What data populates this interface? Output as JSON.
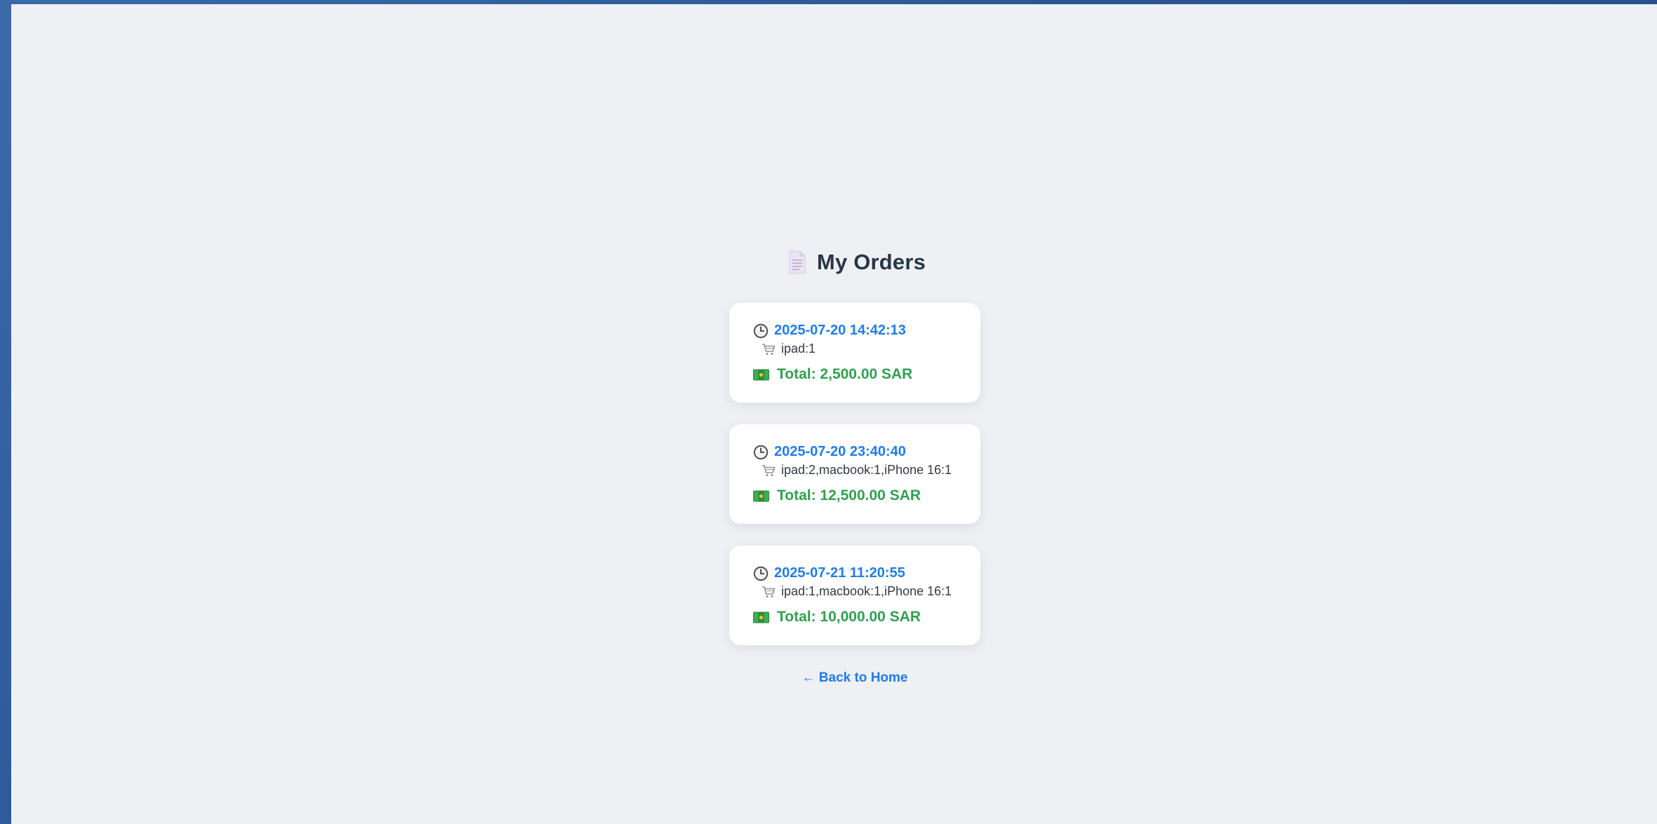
{
  "page": {
    "title": "My Orders",
    "title_icon": "document-icon",
    "background_color": "#eff0f4",
    "frame_color": "#2a5596"
  },
  "orders": [
    {
      "time": "2025-07-20 14:42:13",
      "items": "ipad:1",
      "total": "Total: 2,500.00 SAR"
    },
    {
      "time": "2025-07-20 23:40:40",
      "items": "ipad:2,macbook:1,iPhone 16:1",
      "total": "Total: 12,500.00 SAR"
    },
    {
      "time": "2025-07-21 11:20:55",
      "items": "ipad:1,macbook:1,iPhone 16:1",
      "total": "Total: 10,000.00 SAR"
    }
  ],
  "icons": {
    "time": "clock-icon",
    "items": "shopping-cart-icon",
    "total": "money-icon"
  },
  "colors": {
    "title": "#263648",
    "time": "#1e7cf0",
    "total": "#2fa14f",
    "link": "#1e7cf0"
  },
  "nav": {
    "back_label": "← Back to Home"
  }
}
